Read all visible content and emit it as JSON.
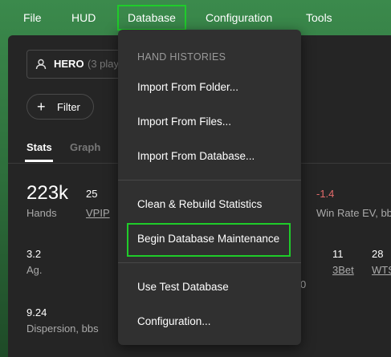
{
  "menubar": {
    "items": [
      "File",
      "HUD",
      "Database",
      "Configuration",
      "Tools"
    ]
  },
  "player_select": {
    "name": "HERO",
    "count": "(3 play"
  },
  "filter": {
    "label": "Filter"
  },
  "tabs": [
    "Stats",
    "Graph"
  ],
  "stats": {
    "hands_value": "223k",
    "hands_label": "Hands",
    "vpip_value": "25",
    "vpip_label": "VPIP",
    "winrate_value": "-1.4",
    "winrate_label": "Win Rate EV, bb/",
    "ag_value": "3.2",
    "ag_label": "Ag.",
    "partial_zero": "0",
    "threebet_value": "11",
    "threebet_label": "3Bet",
    "wts_value": "28",
    "wts_label": "WTS",
    "dispersion_value": "9.24",
    "dispersion_label": "Dispersion, bbs"
  },
  "database_menu": {
    "header": "HAND HISTORIES",
    "import_folder": "Import From Folder...",
    "import_files": "Import From Files...",
    "import_database": "Import From Database...",
    "clean_rebuild": "Clean & Rebuild Statistics",
    "begin_maintenance": "Begin Database Maintenance",
    "use_test_db": "Use Test Database",
    "configuration": "Configuration..."
  },
  "colors": {
    "highlight": "#1fcc2a",
    "negative": "#e36b6b",
    "menu_bg": "#303030"
  }
}
